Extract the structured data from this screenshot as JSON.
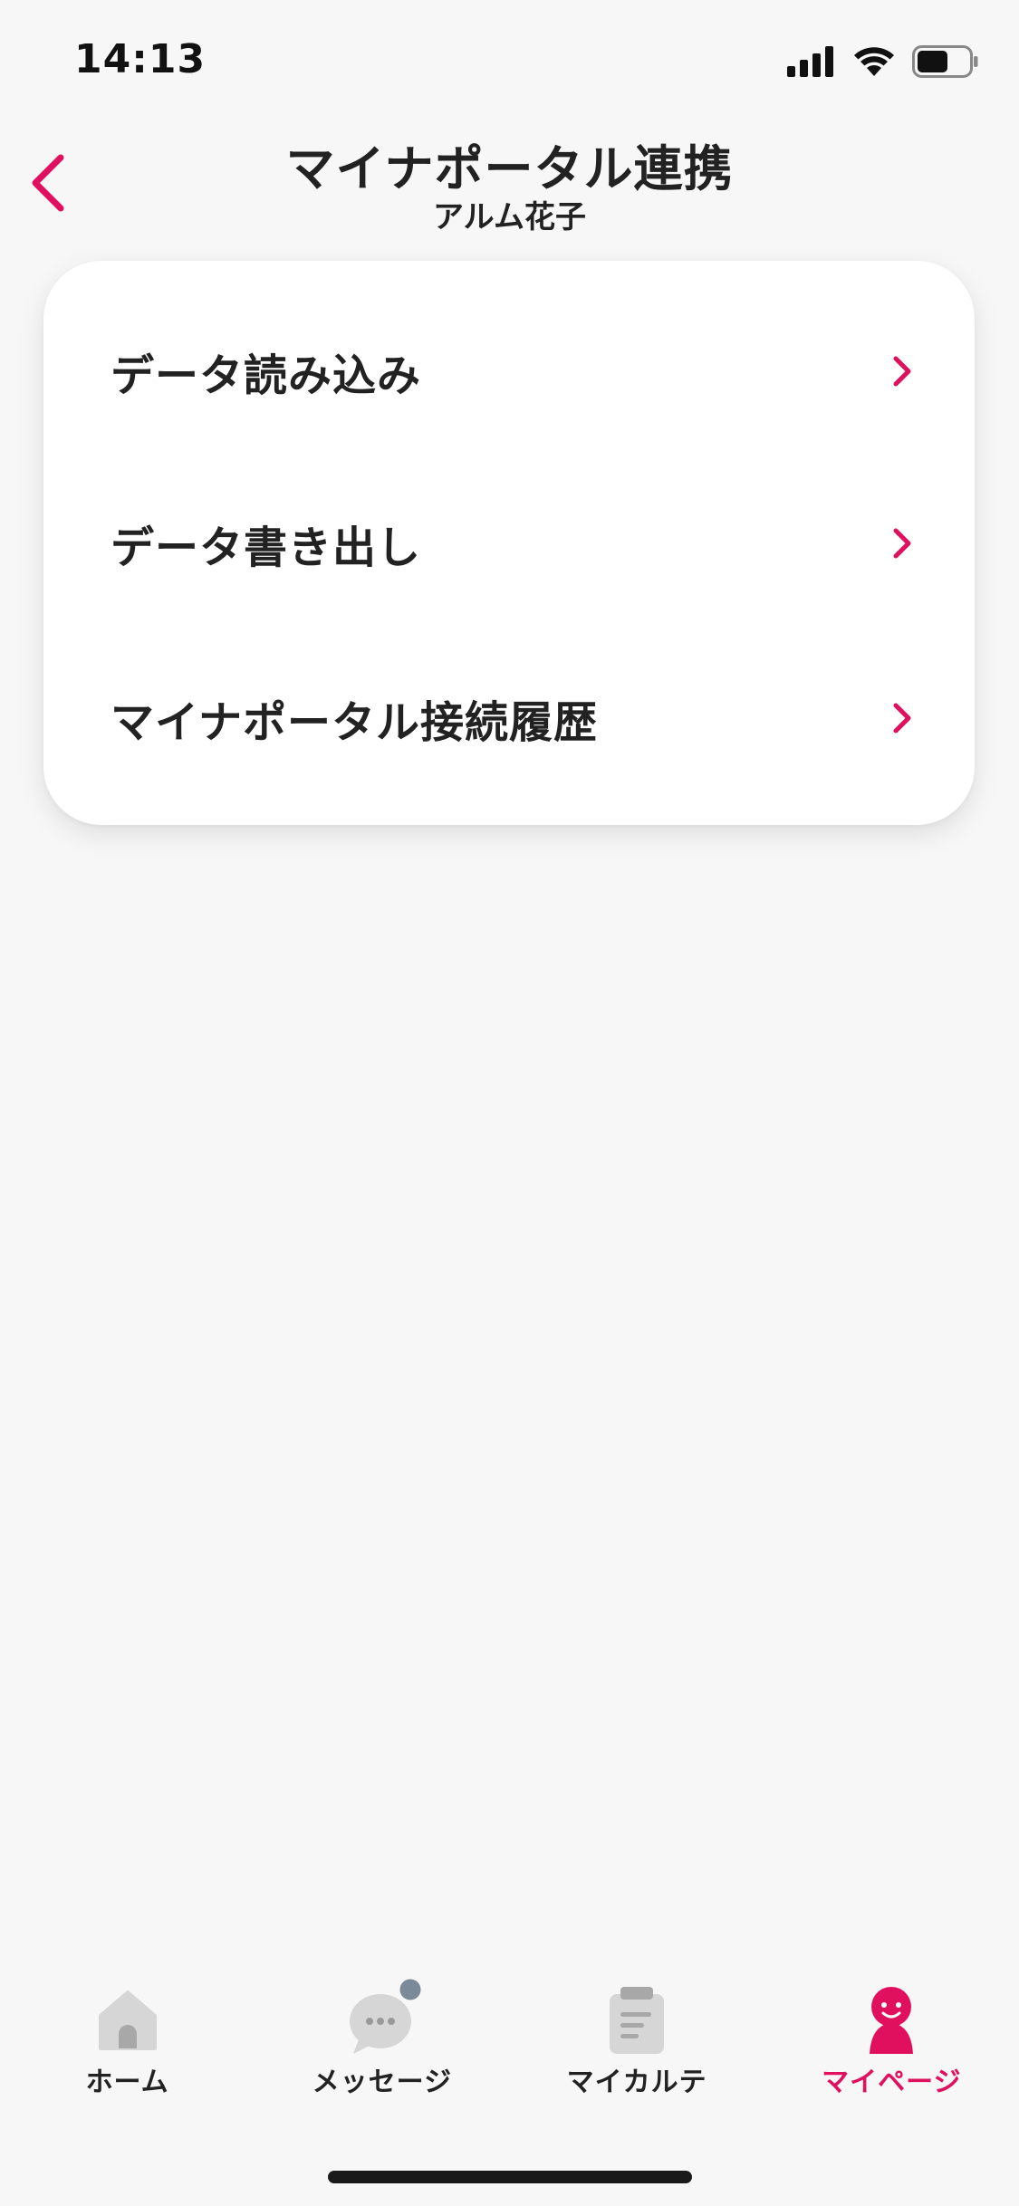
{
  "status_bar": {
    "time": "14:13",
    "icons": [
      "signal-icon",
      "wifi-icon",
      "battery-icon"
    ],
    "battery_level": 0.6
  },
  "header": {
    "title": "マイナポータル連携",
    "subtitle": "アルム花子",
    "back_icon": "chevron-left-icon"
  },
  "menu": {
    "items": [
      {
        "label": "データ読み込み"
      },
      {
        "label": "データ書き出し"
      },
      {
        "label": "マイナポータル接続履歴"
      }
    ]
  },
  "tabbar": {
    "tabs": [
      {
        "label": "ホーム",
        "icon": "home-icon",
        "active": false
      },
      {
        "label": "メッセージ",
        "icon": "message-bubble-icon",
        "active": false,
        "has_badge": true
      },
      {
        "label": "マイカルテ",
        "icon": "clipboard-icon",
        "active": false
      },
      {
        "label": "マイページ",
        "icon": "person-icon",
        "active": true
      }
    ]
  },
  "colors": {
    "accent": "#e0105e",
    "background": "#f7f7f7",
    "card": "#ffffff",
    "text": "#222222",
    "inactive_icon": "#d6d6d6",
    "badge": "#7a8a99"
  }
}
